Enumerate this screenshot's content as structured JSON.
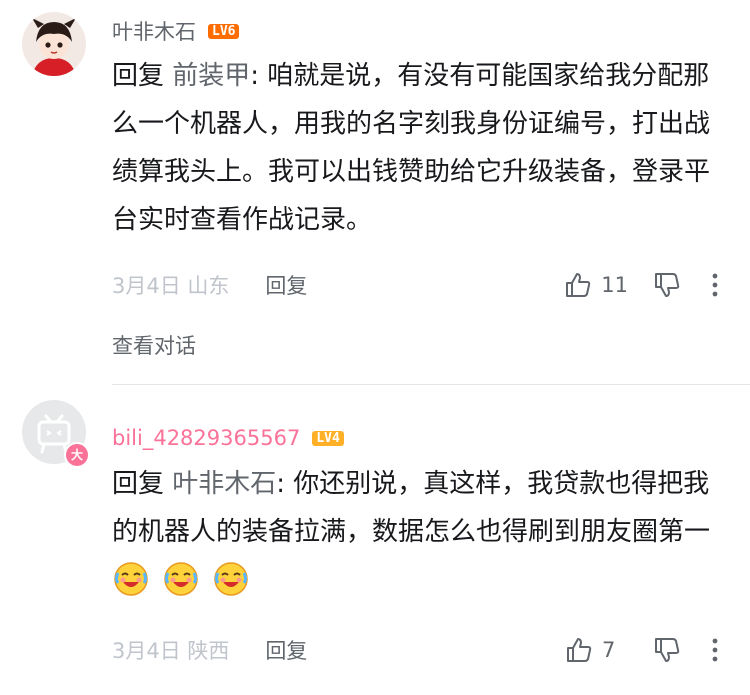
{
  "comments": [
    {
      "username": "叶非木石",
      "level": "LV6",
      "reply_prefix": "回复 ",
      "reply_to": "前装甲",
      "text": ": 咱就是说，有没有可能国家给我分配那么一个机器人，用我的名字刻我身份证编号，打出战绩算我头上。我可以出钱赞助给它升级装备，登录平台实时查看作战记录。",
      "date_location": "3月4日 山东",
      "reply_label": "回复",
      "likes": "11",
      "view_conversation": "查看对话"
    },
    {
      "username": "bili_42829365567",
      "level": "LV4",
      "reply_prefix": "回复 ",
      "reply_to": "叶非木石",
      "text": ": 你还别说，真这样，我贷款也得把我的机器人的装备拉满，数据怎么也得刷到朋友圈第一",
      "emojis": [
        "laughing-cry-emoji",
        "laughing-cry-emoji",
        "laughing-cry-emoji"
      ],
      "date_location": "3月4日 陕西",
      "reply_label": "回复",
      "likes": "7",
      "avatar_badge": "大"
    }
  ],
  "colors": {
    "text": "#18191c",
    "secondary": "#61666d",
    "muted": "#c0c4cc",
    "vip_pink": "#fb7299",
    "lv6": "#ff6c00",
    "lv4": "#ffb027"
  }
}
